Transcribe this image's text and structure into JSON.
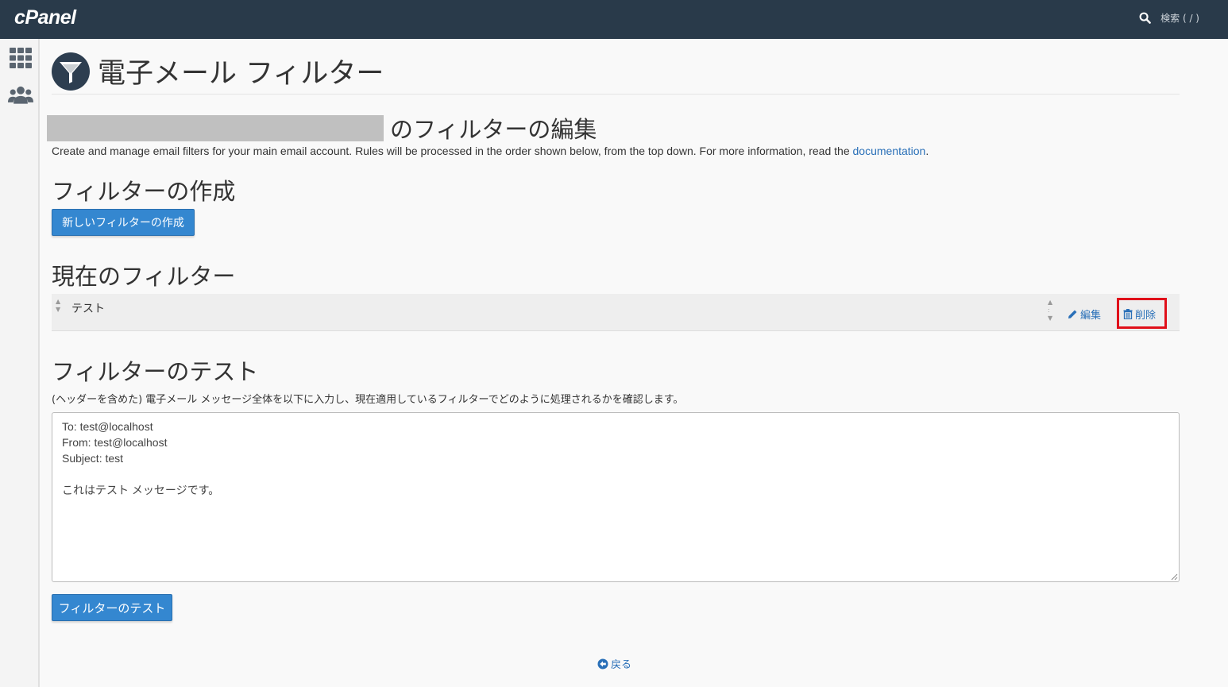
{
  "topbar": {
    "logo": "cPanel",
    "search_label": "検索 ( / )"
  },
  "sidebar": {
    "items": [
      {
        "icon": "grid-icon"
      },
      {
        "icon": "users-icon"
      }
    ]
  },
  "page": {
    "title": "電子メール フィルター",
    "icon": "funnel-icon",
    "account_title": "のフィルターの編集",
    "description_prefix": "Create and manage email filters for your main email account. Rules will be processed in the order shown below, from the top down. For more information, read the ",
    "description_link": "documentation",
    "description_suffix": "."
  },
  "create": {
    "heading": "フィルターの作成",
    "button_label": "新しいフィルターの作成"
  },
  "current": {
    "heading": "現在のフィルター",
    "filters": [
      {
        "name": "テスト",
        "edit_label": "編集",
        "delete_label": "削除"
      }
    ]
  },
  "test": {
    "heading": "フィルターのテスト",
    "description": "(ヘッダーを含めた) 電子メール メッセージ全体を以下に入力し、現在適用しているフィルターでどのように処理されるかを確認します。",
    "message": "To: test@localhost\nFrom: test@localhost\nSubject: test\n\nこれはテスト メッセージです。",
    "button_label": "フィルターのテスト"
  },
  "footer": {
    "back_label": "戻る"
  },
  "colors": {
    "topbar": "#293a4a",
    "primary": "#3487d0",
    "link": "#2a70b8",
    "highlight": "#e0101a"
  }
}
